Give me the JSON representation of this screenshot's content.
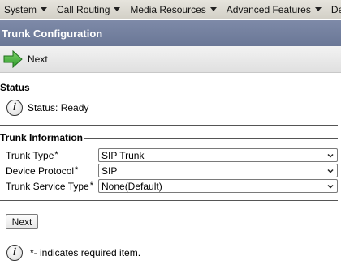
{
  "menu": {
    "items": [
      {
        "label": "System"
      },
      {
        "label": "Call Routing"
      },
      {
        "label": "Media Resources"
      },
      {
        "label": "Advanced Features"
      },
      {
        "label": "Device"
      }
    ]
  },
  "page": {
    "title": "Trunk Configuration"
  },
  "toolbar": {
    "next_label": "Next",
    "next_icon": "green-right-arrow-icon"
  },
  "status": {
    "legend": "Status",
    "text": "Status: Ready",
    "icon": "info-icon"
  },
  "trunk_info": {
    "legend": "Trunk Information",
    "fields": [
      {
        "label": "Trunk Type",
        "required_marker": "*",
        "value": "SIP Trunk"
      },
      {
        "label": "Device Protocol",
        "required_marker": "*",
        "value": "SIP"
      },
      {
        "label": "Trunk Service Type",
        "required_marker": "*",
        "value": "None(Default)"
      }
    ]
  },
  "footer": {
    "next_button_label": "Next",
    "required_note": "*- indicates required item."
  },
  "colors": {
    "titlebar": "#7482a1",
    "menubar": "#dedbd3",
    "next_arrow": "#3aa935"
  }
}
